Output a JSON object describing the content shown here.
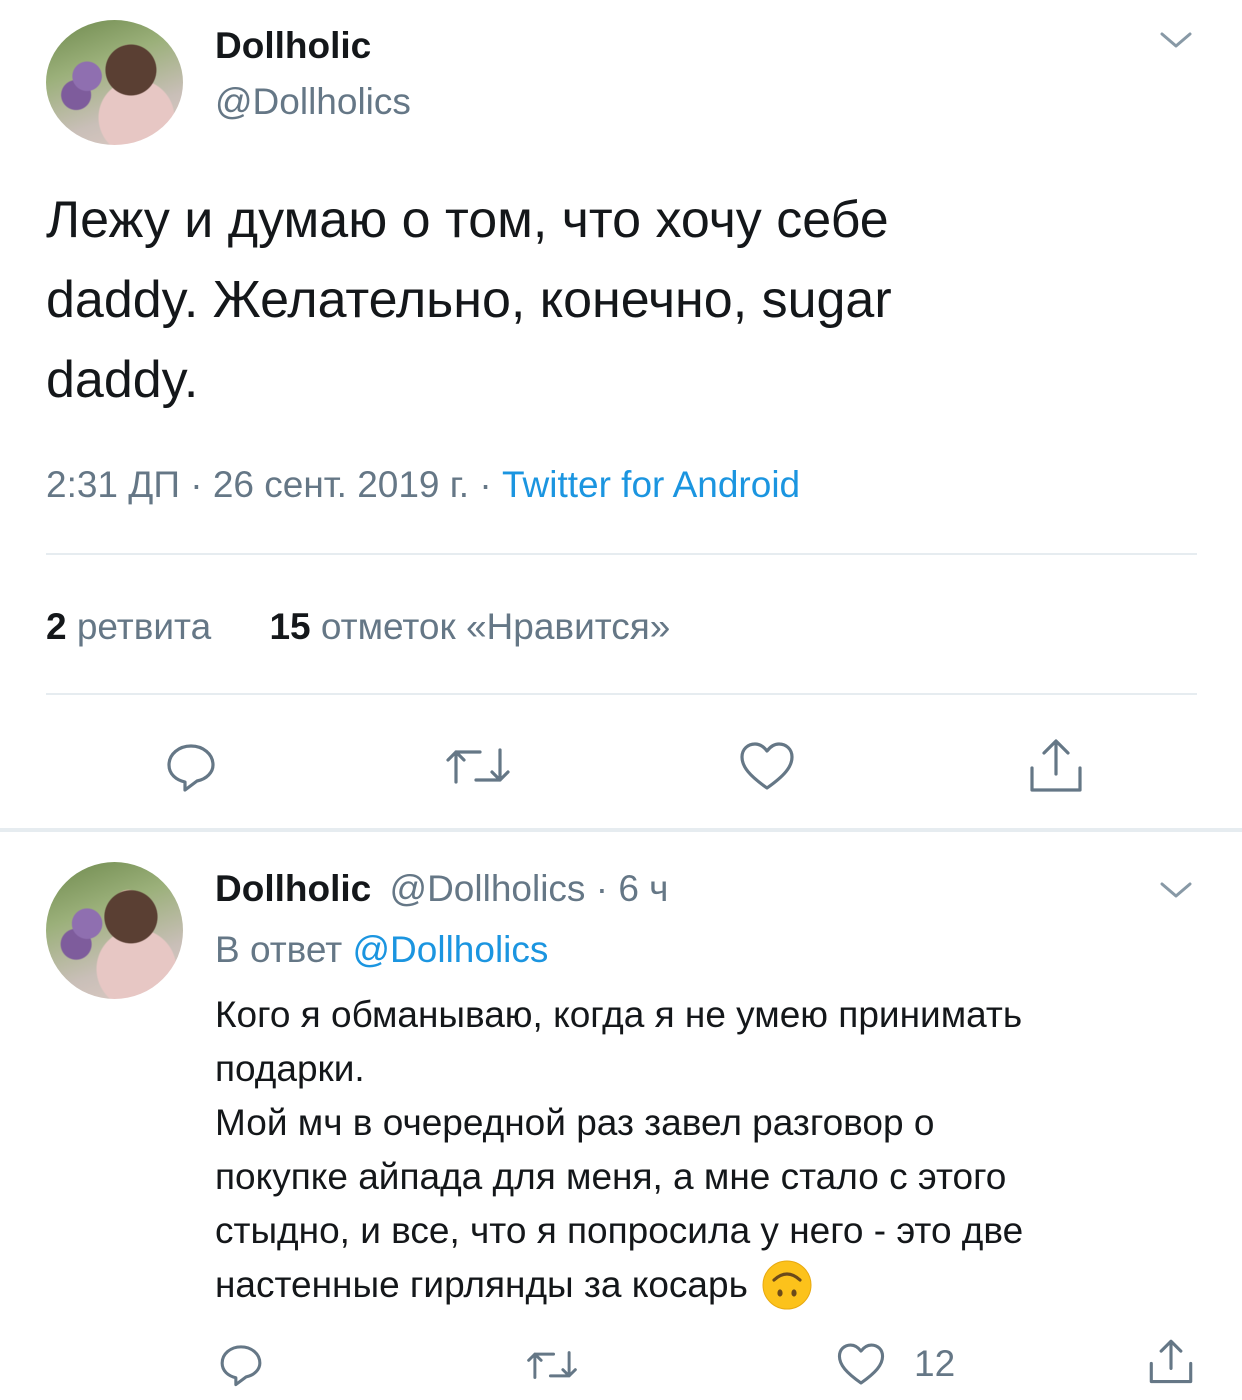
{
  "main_tweet": {
    "author_name": "Dollholic",
    "author_handle": "@Dollholics",
    "text_lines": [
      "Лежу и думаю о том, что хочу себе",
      "daddy. Желательно, конечно,  sugar",
      "daddy."
    ],
    "time": "2:31 ДП",
    "date": "26 сент. 2019 г.",
    "source": "Twitter for Android",
    "retweet_count": "2",
    "retweet_label": "ретвита",
    "like_count": "15",
    "like_label": "отметок «Нравится»"
  },
  "reply_tweet": {
    "author_name": "Dollholic",
    "author_handle": "@Dollholics",
    "age": "6 ч",
    "reply_prefix": "В ответ",
    "reply_to": "@Dollholics",
    "text_lines": [
      "Кого я обманываю, когда я не умею принимать",
      "подарки.",
      "Мой мч в очередной раз завел разговор о",
      "покупке айпада для меня, а мне стало с этого",
      "стыдно, и все, что я попросила у него - это две",
      "настенные гирлянды за косарь"
    ],
    "emoji": "upside-down-face-emoji",
    "like_count": "12"
  },
  "icons": {
    "reply": "reply-icon",
    "retweet": "retweet-icon",
    "like": "heart-icon",
    "share": "share-icon",
    "menu": "chevron-down-icon"
  },
  "colors": {
    "text": "#14171a",
    "muted": "#657786",
    "link": "#1b95e0",
    "divider": "#e6ecf0"
  }
}
